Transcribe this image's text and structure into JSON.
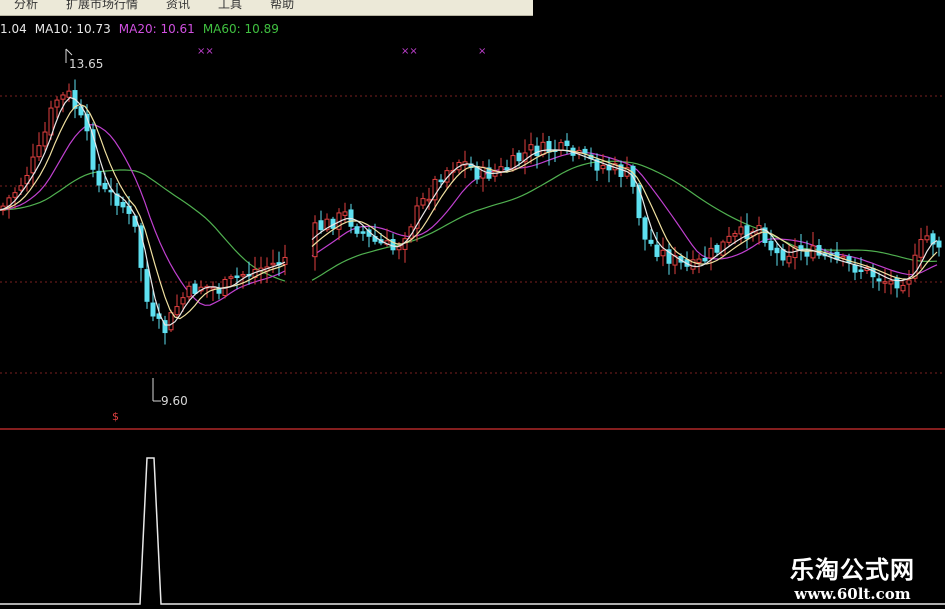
{
  "menubar": {
    "items": [
      "分析",
      "扩展市场行情",
      "资讯",
      "工具",
      "帮助"
    ]
  },
  "ma_legend": {
    "ma5": "1.04",
    "ma10": "MA10: 10.73",
    "ma20": "MA20: 10.61",
    "ma60": "MA60: 10.89"
  },
  "annotations": {
    "high_label": "13.65",
    "low_label": "9.60",
    "signal_marker": "$",
    "top_marks": [
      "××",
      "××",
      "×"
    ]
  },
  "colors": {
    "up": "#e04040",
    "down": "#5ee0f0",
    "ma5": "#e8e8e8",
    "ma10": "#f0e0a0",
    "ma20": "#c040d0",
    "ma60": "#50b050",
    "divider": "#b02828",
    "grid": "#7a2020"
  },
  "watermark": {
    "title": "乐淘公式网",
    "url": "www.60lt.com"
  }
}
